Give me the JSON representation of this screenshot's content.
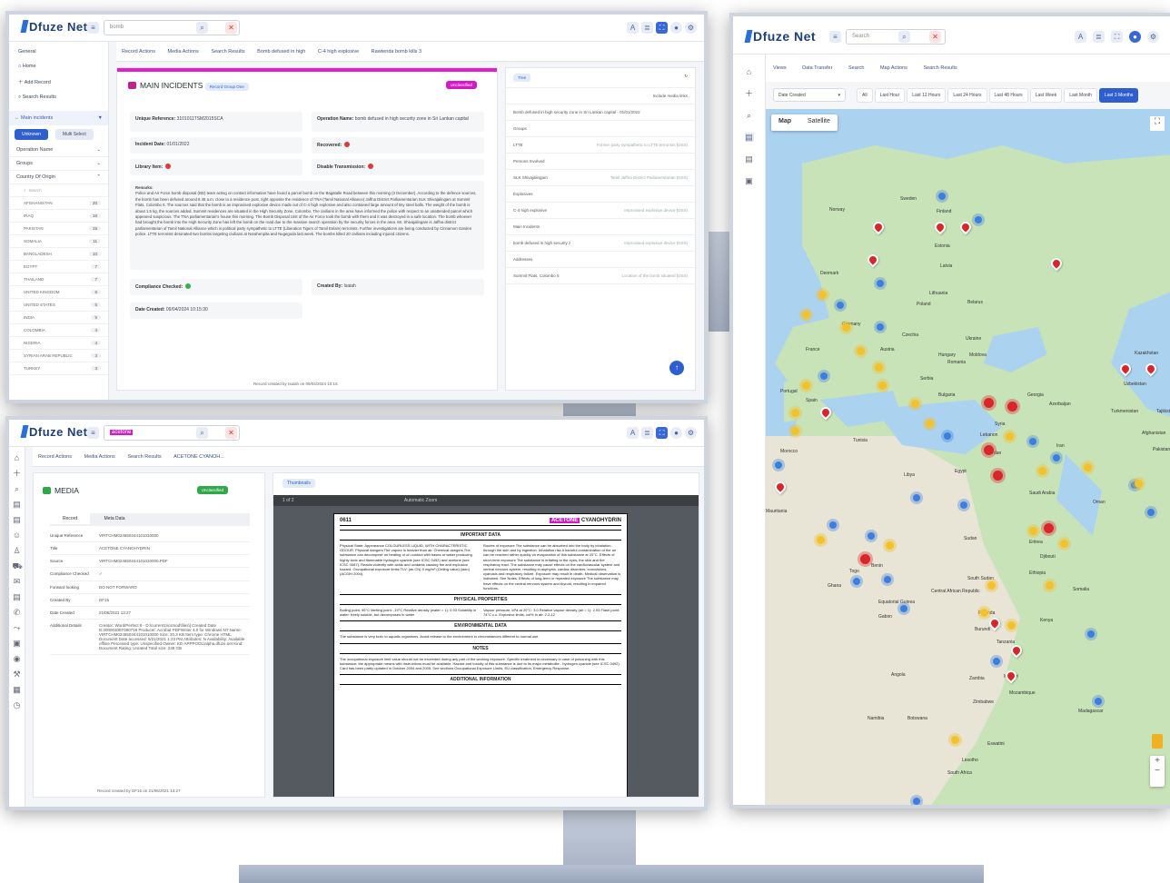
{
  "brand": {
    "name": "Dfuze Net"
  },
  "monitor1": {
    "search_value": "bomb",
    "home": "Home",
    "add_record": "Add Record",
    "search_results": "Search Results",
    "filter_title": "Main incidents",
    "pills": [
      "Unknown",
      "Multi Select"
    ],
    "groups": [
      "Operation Name",
      "Groups",
      "Country Of Origin"
    ],
    "country_search_placeholder": "Search",
    "countries": [
      {
        "name": "AFGHANISTAN",
        "count": "20"
      },
      {
        "name": "IRAQ",
        "count": "16"
      },
      {
        "name": "PAKISTAN",
        "count": "15"
      },
      {
        "name": "SOMALIA",
        "count": "11"
      },
      {
        "name": "BANGLADESH",
        "count": "10"
      },
      {
        "name": "EGYPT",
        "count": "7"
      },
      {
        "name": "THAILAND",
        "count": "7"
      },
      {
        "name": "UNITED KINGDOM",
        "count": "6"
      },
      {
        "name": "UNITED STATES",
        "count": "5"
      },
      {
        "name": "INDIA",
        "count": "5"
      },
      {
        "name": "COLOMBIA",
        "count": "4"
      },
      {
        "name": "NIGERIA",
        "count": "4"
      },
      {
        "name": "SYRIAN ARAB REPUBLIC",
        "count": "3"
      },
      {
        "name": "TURKEY",
        "count": "3"
      }
    ],
    "tabs": [
      "Record Actions",
      "Media Actions",
      "Search Results",
      "Bomb defused in high",
      "C-4 high explosive",
      "Rawtenda bomb kills 3"
    ],
    "card_title": "MAIN INCIDENTS",
    "card_badge": "Record Group One",
    "classification": "Unclassified",
    "unique_ref_label": "Unique Reference:",
    "unique_ref_value": "3101011TSM2015SCA",
    "operation_name_label": "Operation Name:",
    "operation_name_value": "bomb defused in high security zone in Sri Lankan capital",
    "incident_date_label": "Incident Date:",
    "incident_date_value": "01/01/2022",
    "recovered_label": "Recovered:",
    "library_item_label": "Library Item:",
    "disable_transmission_label": "Disable Transmission:",
    "remarks_label": "Remarks:",
    "remarks_text": "Police and Air Force bomb disposal (BD) team acting on contact information have found a parcel bomb on the Bagatalle Road between this morning (3 December). According to the defence sources, the bomb has been defused around 8.45 a.m. close to a residence post, right opposite the residence of TNA (Tamil National Alliance) Jaffna District Parliamentarian SLK Shivajalingam at Summit Flats, Colombo 5. The sources said that the bomb is an improvised explosive device made out of C-4 high explosive and also contained large amount of tiny steel balls. The weight of the bomb is about 1.5 kg, the sources added. Summit residences are situated in the High Security Zone, Colombo. The civilians in the area have informed the police with respect to an unattended parcel which appeared suspicious. The TNA parliamentarian's house this morning. The Bomb Disposal Unit of the Air Force took the bomb with them and it was destroyed in a safe location. The bomb whoever had brought the bomb into the High Security Zone has left the bomb on the road due to the massive search operation by the security forces in the area. Mr. Shivajalingam is Jaffna district parliamentarian of Tamil National Alliance which is political party sympathetic to LTTE (Liberation Tigers of Tamil Eelam) terrorists. Further investigations are being conducted by Cinnamon Garden police. LTTE terrorists detonated two bombs targeting civilians at Narahenpita and Nugegoda last week. The bombs killed 20 civilians including injured citizens.",
    "compliance_label": "Compliance Checked:",
    "created_by_label": "Created By:",
    "created_by_value": "Isaiah",
    "date_created_label": "Date Created:",
    "date_created_value": "09/04/2024 10:15:30",
    "footer": "Record created by Isaiah on 09/04/2024 10:15",
    "tree_view": "Tree",
    "tree_include": "Include media links",
    "tree_rows": [
      {
        "label": "Bomb defused in high security zone in Sri Lankan capital - 01/01/2022",
        "meta": ""
      },
      {
        "label": "Groups",
        "meta": ""
      },
      {
        "label": "LTTE",
        "meta": "Former party sympathetic to LTTE terrorists (DSS)"
      },
      {
        "label": "Persons Involved",
        "meta": ""
      },
      {
        "label": "SLK Shivajalingam",
        "meta": "Tamil Jaffna District Parliamentarian (DSS)"
      },
      {
        "label": "Explosives",
        "meta": ""
      },
      {
        "label": "C-4 high explosive",
        "meta": "Improvised explosive device (DSS)"
      },
      {
        "label": "Main Incidents",
        "meta": ""
      },
      {
        "label": "bomb defused in high security z",
        "meta": "Improvised explosive device (DSS)"
      },
      {
        "label": "Addresses",
        "meta": ""
      },
      {
        "label": "Summit Flats, Colombo 5",
        "meta": "Location of the bomb situated (DSS)"
      }
    ]
  },
  "monitor2": {
    "search_value": "acetone",
    "tabs": [
      "Record Actions",
      "Media Actions",
      "Search Results",
      "ACETONE CYANOH..."
    ],
    "card_title": "MEDIA",
    "classification": "Unclassified",
    "sub_tabs": [
      "Record",
      "Meta Data"
    ],
    "rows": [
      {
        "k": "Unique Reference",
        "v": "VIRTCHM024650344101010000"
      },
      {
        "k": "Title",
        "v": "ACETONE CYANOHYDRIN"
      },
      {
        "k": "Source",
        "v": "VIRTCHM024650344101010000.PDF"
      },
      {
        "k": "Compliance Checked",
        "v": "✓"
      },
      {
        "k": "Forward looking",
        "v": "DO NOT FORWARD"
      },
      {
        "k": "Created By",
        "v": "DF15"
      },
      {
        "k": "Date Created",
        "v": "21/06/2021 13:27"
      },
      {
        "k": "Additional Details",
        "v": "Creator: Word/Perfect 9 - D:\\current1\\icsmod\\files\\] Created Date D:20000306T090716 Producer: Acrobat PDFWriter 4.0 for Windows NT Name: VIRTCHM024650344101010000 Size: 20.3 KB Item type: Chrome HTML Document Date accessed: 6/21/2021 1:23 PM Attributes: N Availability: Available offline Perceived type: Unspecified Owner: KE-APPPOOL\\alpha.dfuze.net Kind: Document Rating: Unrated Total size: 238 GB"
      }
    ],
    "footer": "Record created by DF15 on 21/06/2021 13:27",
    "viewer_mode": "Thumbnails",
    "page_indicator": "1 of 2",
    "zoom": "Automatic Zoom",
    "pdf": {
      "code": "0611",
      "title_hl": "ACETONE",
      "title_rest": " CYANOHYDRIN",
      "important": "IMPORTANT DATA",
      "left_col": "Physical State; Appearance COLOURLESS LIQUID, WITH CHARACTERISTIC ODOUR. Physical dangers The vapour is heavier than air. Chemical dangers The substance can decompose on heating or on contact with bases or water producing highly toxic and flammable hydrogen cyanide (see ICSC 0492) and acetone (see ICSC 0087). Reacts violently with acids and oxidants causing fire and explosion hazard. Occupational exposure limits TLV: (as CN) 5 mg/m³ (Ceiling value) (skin) (ACGIH 2004).",
      "right_col": "Routes of exposure The substance can be absorbed into the body by inhalation, through the skin and by ingestion. Inhalation risk A harmful contamination of the air can be reached rather quickly on evaporation of this substance at 20°C. Effects of short-term exposure The substance is irritating to the eyes, the skin and the respiratory tract. The substance may cause effects on the cardiovascular system and central nervous system, resulting in asphyxia, cardiac disorders, convulsions, cyanosis and respiratory failure. Exposure may result in death. Medical observation is indicated. See Notes. Effects of long-term or repeated exposure The substance may have effects on the central nervous system and thyroid, resulting in impaired functions.",
      "physical": "PHYSICAL PROPERTIES",
      "phys_left": "Boiling point: 95°C Melting point: -19°C Relative density (water = 1): 0.93 Solubility in water: freely soluble, but decomposes in water",
      "phys_right": "Vapour pressure, kPa at 20°C: 3.0 Relative vapour density (air = 1): 2.93 Flash point: 74°C c.c. Explosive limits, vol% in air: 2.2-12",
      "environmental": "ENVIRONMENTAL DATA",
      "env_text": "The substance is very toxic to aquatic organisms. Avoid release to the environment in circumstances different to normal use.",
      "notes": "NOTES",
      "notes_text": "The occupational exposure limit value should not be exceeded during any part of the working exposure. Specific treatment is necessary in case of poisoning with this substance; the appropriate means with instructions must be available. Hazard and toxicity of this substance is due to its major metabolite - hydrogen cyanide (see ICSC 0492). Card has been partly updated in October 2004 and 2005. See sections Occupational Exposure Limits, EU classification, Emergency Response.",
      "additional": "ADDITIONAL INFORMATION"
    }
  },
  "monitor3": {
    "search_placeholder": "Search",
    "nav": [
      "Views",
      "Data Transfer",
      "Search",
      "Map Actions",
      "Search Results"
    ],
    "date_select": "Date Created",
    "ranges": [
      "All",
      "Last Hour",
      "Last 12 Hours",
      "Last 24 Hours",
      "Last 48 Hours",
      "Last Week",
      "Last Month",
      "Last 3 Months"
    ],
    "map_tabs": [
      "Map",
      "Satellite"
    ],
    "labels": [
      "Sweden",
      "Norway",
      "Finland",
      "Estonia",
      "Latvia",
      "Lithuania",
      "Denmark",
      "Poland",
      "Belarus",
      "Germany",
      "Czechia",
      "Ukraine",
      "France",
      "Austria",
      "Hungary",
      "Moldova",
      "Romania",
      "Serbia",
      "Bulgaria",
      "Georgia",
      "Azerbaijan",
      "Turkmenistan",
      "Uzbekistan",
      "Tajikistan",
      "Portugal",
      "Spain",
      "Tunisia",
      "Morocco",
      "Libya",
      "Egypt",
      "Syria",
      "Lebanon",
      "Jordan",
      "Iran",
      "Afghanistan",
      "Pakistan",
      "Saudi Arabia",
      "Oman",
      "Sudan",
      "Eritrea",
      "Djibouti",
      "Ethiopia",
      "South Sudan",
      "Somalia",
      "Kenya",
      "Rwanda",
      "Burundi",
      "Tanzania",
      "Angola",
      "Zambia",
      "Malawi",
      "Mozambique",
      "Zimbabwe",
      "Namibia",
      "Botswana",
      "Madagascar",
      "South Africa",
      "Lesotho",
      "Eswatini",
      "Benin",
      "Togo",
      "Ghana",
      "Gabon",
      "Equatorial Guinea",
      "Central African Republic",
      "Mauritania",
      "Kazakhstan"
    ]
  }
}
